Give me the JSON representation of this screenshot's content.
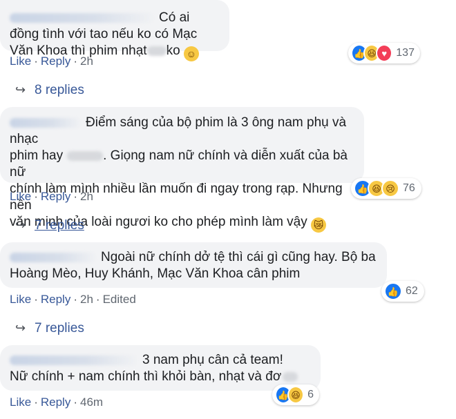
{
  "comments": [
    {
      "text_a": "Có ai đồng tình với tao nếu ko có Mạc",
      "text_b": "Văn Khoa thì phim nhạt",
      "text_c": "ko",
      "emoji": "☺",
      "actions": {
        "like": "Like",
        "reply": "Reply",
        "time": "2h"
      },
      "reaction_count": "137",
      "reaction_icons": [
        "like-icon",
        "haha-icon",
        "love-icon"
      ],
      "replies_label": "8 replies"
    },
    {
      "text_a": "Điểm sáng của bộ phim là 3 ông nam phụ và nhạc",
      "text_b1": "phim hay",
      "text_b2": ". Giọng nam nữ chính và diễn xuất của bà nữ",
      "text_c": "chính làm mình nhiều lần muốn đi ngay trong rạp. Nhưng nền",
      "text_d": "văn minh của loài ngươi ko cho phép mình làm vậy",
      "emoji": "😿",
      "actions": {
        "like": "Like",
        "reply": "Reply",
        "time": "2h"
      },
      "reaction_count": "76",
      "reaction_icons": [
        "like-icon",
        "haha-icon",
        "sad-icon"
      ],
      "replies_label": "7 replies"
    },
    {
      "text_a": "Ngoài nữ chính dở tệ thì cái gì cũng hay. Bộ ba",
      "text_b": "Hoàng Mèo, Huy Khánh, Mạc Văn Khoa cân phim",
      "actions": {
        "like": "Like",
        "reply": "Reply",
        "time": "2h",
        "edited": "Edited"
      },
      "reaction_count": "62",
      "reaction_icons": [
        "like-icon"
      ],
      "replies_label": "7 replies"
    },
    {
      "text_a": "3 nam phụ cân cả team!",
      "text_b": "Nữ chính + nam chính thì khỏi bàn, nhạt và đơ",
      "actions": {
        "like": "Like",
        "reply": "Reply",
        "time": "46m"
      },
      "reaction_count": "6",
      "reaction_icons": [
        "like-icon",
        "haha-icon"
      ]
    }
  ],
  "sep": "·",
  "arrow": "↪",
  "colors": {
    "link": "#385898",
    "bubble": "#f2f3f5",
    "like": "#1877f2"
  }
}
